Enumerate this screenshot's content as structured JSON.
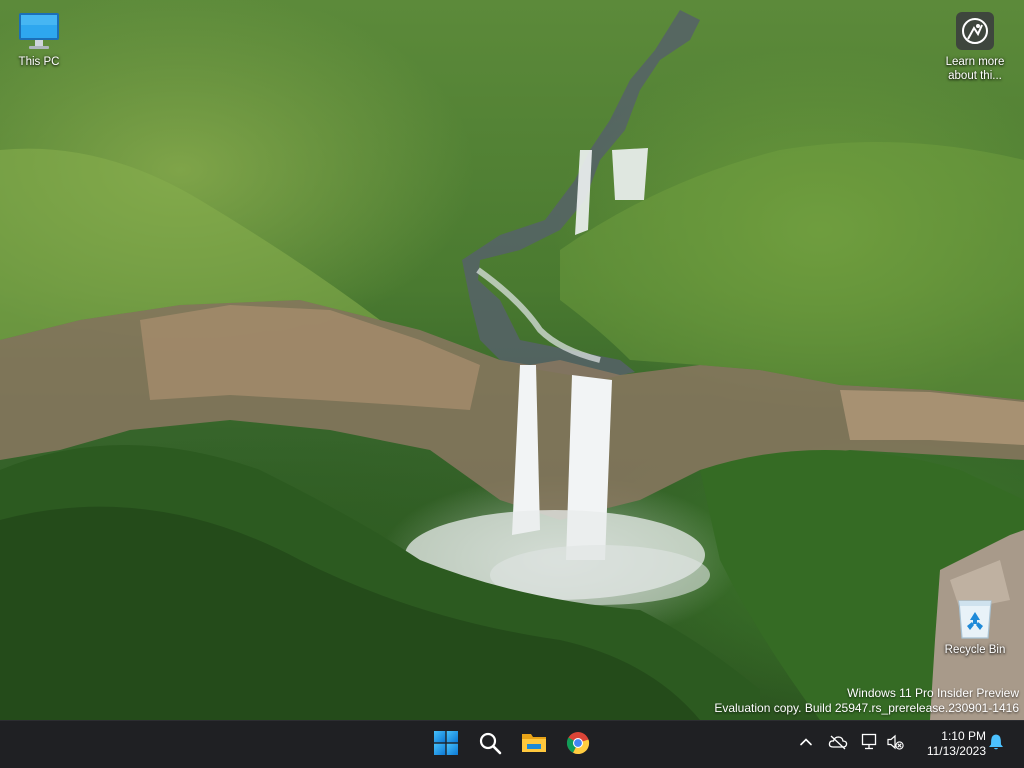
{
  "desktop": {
    "icons": [
      {
        "label": "This PC",
        "icon": "this-pc-icon"
      },
      {
        "label": "Learn more about thi...",
        "label_line1": "Learn more",
        "label_line2": "about thi...",
        "icon": "learn-more-icon"
      },
      {
        "label": "Recycle Bin",
        "icon": "recycle-bin-icon"
      }
    ],
    "watermark": {
      "line1": "Windows 11 Pro Insider Preview",
      "line2": "Evaluation copy. Build 25947.rs_prerelease.230901-1416"
    }
  },
  "taskbar": {
    "pinned": [
      {
        "name": "start-button",
        "icon": "windows-logo-icon"
      },
      {
        "name": "search-button",
        "icon": "search-icon"
      },
      {
        "name": "file-explorer-button",
        "icon": "folder-icon"
      },
      {
        "name": "chrome-button",
        "icon": "chrome-icon"
      }
    ],
    "tray": {
      "icons": [
        "chevron-up-icon",
        "onedrive-offline-icon",
        "network-icon",
        "volume-muted-icon",
        "notification-bell-icon"
      ],
      "time": "1:10 PM",
      "date": "11/13/2023"
    }
  },
  "colors": {
    "taskbar_bg": "#1f2023",
    "accent": "#0078d4",
    "start_blue": "#1fa0ee"
  }
}
